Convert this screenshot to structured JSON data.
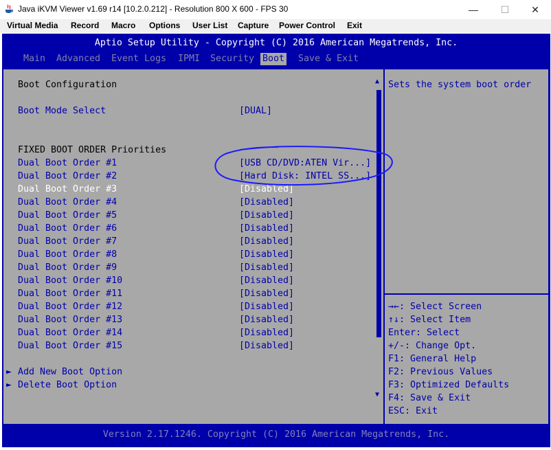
{
  "window": {
    "title": "Java iKVM Viewer v1.69 r14 [10.2.0.212]  - Resolution 800 X 600 - FPS 30",
    "minimize": "—",
    "maximize": "☐",
    "close": "✕"
  },
  "menu": [
    "Virtual Media",
    "Record",
    "Macro",
    "Options",
    "User List",
    "Capture",
    "Power Control",
    "Exit"
  ],
  "bios": {
    "header": "Aptio Setup Utility - Copyright (C) 2016 American Megatrends, Inc.",
    "tabs": [
      "Main",
      "Advanced",
      "Event Logs",
      "IPMI",
      "Security",
      "Boot",
      "Save & Exit"
    ],
    "active_tab": "Boot",
    "section_title": "Boot Configuration",
    "boot_mode_label": "Boot Mode Select",
    "boot_mode_value": "[DUAL]",
    "priorities_title": "FIXED BOOT ORDER Priorities",
    "boot_order": [
      {
        "label": "Dual Boot Order #1",
        "value": "[USB CD/DVD:ATEN Vir...]"
      },
      {
        "label": "Dual Boot Order #2",
        "value": "[Hard Disk: INTEL SS...]"
      },
      {
        "label": "Dual Boot Order #3",
        "value": "[Disabled]"
      },
      {
        "label": "Dual Boot Order #4",
        "value": "[Disabled]"
      },
      {
        "label": "Dual Boot Order #5",
        "value": "[Disabled]"
      },
      {
        "label": "Dual Boot Order #6",
        "value": "[Disabled]"
      },
      {
        "label": "Dual Boot Order #7",
        "value": "[Disabled]"
      },
      {
        "label": "Dual Boot Order #8",
        "value": "[Disabled]"
      },
      {
        "label": "Dual Boot Order #9",
        "value": "[Disabled]"
      },
      {
        "label": "Dual Boot Order #10",
        "value": "[Disabled]"
      },
      {
        "label": "Dual Boot Order #11",
        "value": "[Disabled]"
      },
      {
        "label": "Dual Boot Order #12",
        "value": "[Disabled]"
      },
      {
        "label": "Dual Boot Order #13",
        "value": "[Disabled]"
      },
      {
        "label": "Dual Boot Order #14",
        "value": "[Disabled]"
      },
      {
        "label": "Dual Boot Order #15",
        "value": "[Disabled]"
      }
    ],
    "selected_index": 2,
    "add_option": "Add New Boot Option",
    "delete_option": "Delete Boot Option",
    "submenu_marker": "►",
    "help_text": "Sets the system boot order",
    "keys": [
      "→←: Select Screen",
      "↑↓: Select Item",
      "Enter: Select",
      "+/-: Change Opt.",
      "F1: General Help",
      "F2: Previous Values",
      "F3: Optimized Defaults",
      "F4: Save & Exit",
      "ESC: Exit"
    ],
    "footer": "Version 2.17.1246. Copyright (C) 2016 American Megatrends, Inc.",
    "scroll_up": "▲",
    "scroll_down": "▼"
  },
  "colors": {
    "bios_blue": "#0000aa",
    "panel_gray": "#a8a8a8",
    "annotation_circle": "#1a1aff"
  }
}
